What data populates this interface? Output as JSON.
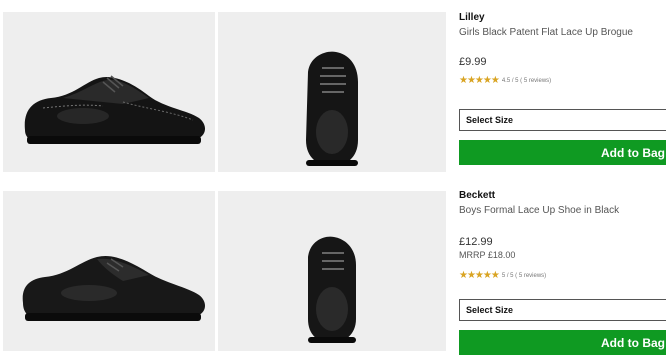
{
  "products": [
    {
      "brand": "Lilley",
      "name": "Girls Black Patent Flat Lace Up Brogue",
      "price": "£9.99",
      "rrp": "",
      "stars": "★★★★★",
      "rating_value": 4.5,
      "rating_text": "4.5 / 5 ( 5 reviews)",
      "select_label": "Select Size",
      "add_label": "Add to Bag",
      "images": [
        "side-view-patent-brogue",
        "front-view-patent-brogue"
      ]
    },
    {
      "brand": "Beckett",
      "name": "Boys Formal Lace Up Shoe in Black",
      "price": "£12.99",
      "rrp": "MRRP £18.00",
      "stars": "★★★★★",
      "rating_value": 5,
      "rating_text": "5 / 5 ( 5 reviews)",
      "select_label": "Select Size",
      "add_label": "Add to Bag",
      "images": [
        "side-view-formal-shoe",
        "front-view-formal-shoe"
      ]
    }
  ],
  "colors": {
    "accent_green": "#0f9a22",
    "star": "#d9a423",
    "image_bg": "#eeeeee"
  }
}
